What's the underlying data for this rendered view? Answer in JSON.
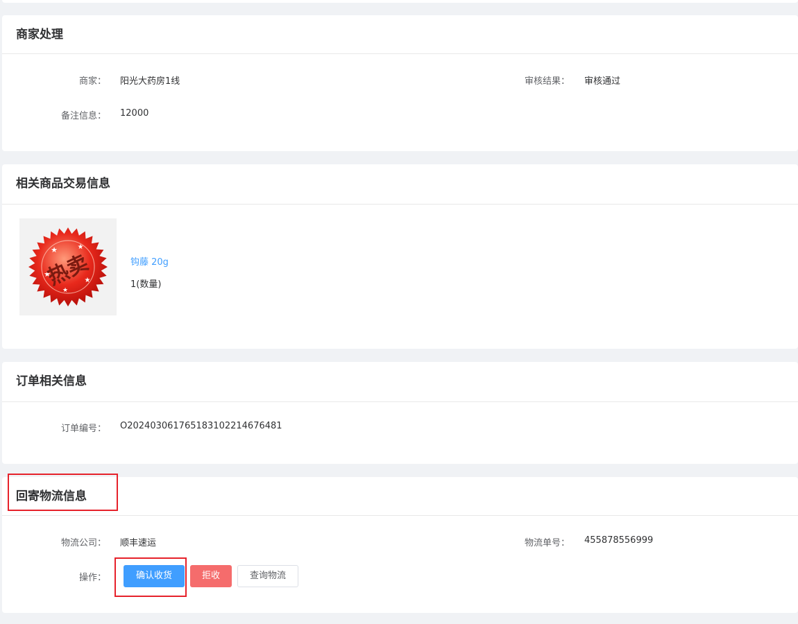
{
  "merchant_section": {
    "title": "商家处理",
    "merchant_label": "商家：",
    "merchant_value": "阳光大药房1线",
    "review_label": "审核结果：",
    "review_value": "审核通过",
    "remark_label": "备注信息：",
    "remark_value": "12000"
  },
  "product_section": {
    "title": "相关商品交易信息",
    "product_name": "钩藤 20g",
    "quantity": "1(数量)",
    "image_seal_text": "热卖"
  },
  "order_section": {
    "title": "订单相关信息",
    "order_no_label": "订单编号：",
    "order_no_value": "O202403061765183102214676481"
  },
  "logistics_section": {
    "title": "回寄物流信息",
    "company_label": "物流公司：",
    "company_value": "顺丰速运",
    "tracking_label": "物流单号：",
    "tracking_value": "455878556999",
    "action_label": "操作：",
    "confirm_button": "确认收货",
    "reject_button": "拒收",
    "track_button": "查询物流"
  },
  "colors": {
    "primary": "#409eff",
    "danger": "#f56c6c",
    "annotation": "#e6212a",
    "background": "#f0f2f5"
  }
}
